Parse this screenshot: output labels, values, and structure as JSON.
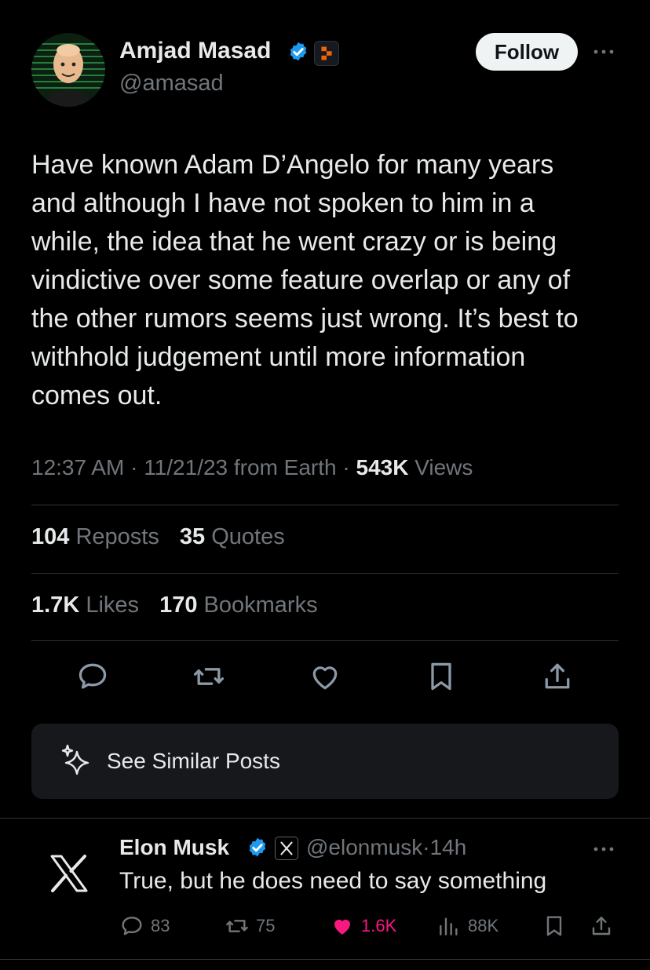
{
  "tweet": {
    "author": {
      "name": "Amjad Masad",
      "handle": "@amasad",
      "verified": true,
      "avatar": "avatar-illustration"
    },
    "follow_label": "Follow",
    "text": "Have known Adam D’Angelo for many years\nand although I have not spoken to him in a\nwhile, the idea that he went crazy or is being\nvindictive over some feature overlap or any of\nthe other rumors seems just wrong. It’s best to\nwithhold judgement until more information\ncomes out.",
    "time": "12:37 AM",
    "date": "11/21/23",
    "source": "from Earth",
    "views_count": "543K",
    "views_label": "Views",
    "separator": "·"
  },
  "stats": {
    "reposts": "104",
    "reposts_label": "Reposts",
    "quotes": "35",
    "quotes_label": "Quotes",
    "likes": "1.7K",
    "likes_label": "Likes",
    "bookmarks": "170",
    "bookmarks_label": "Bookmarks"
  },
  "actions": [
    "reply-icon",
    "repost-icon",
    "like-icon",
    "bookmark-icon",
    "share-icon"
  ],
  "similar_posts": {
    "label": "See Similar Posts",
    "icon": "sparkle-icon"
  },
  "reply": {
    "author_name": "Elon Musk",
    "handle": "@elonmusk",
    "time": "14h",
    "separator": "·",
    "text": "True, but he does need to say something",
    "replies": "83",
    "reposts": "75",
    "likes": "1.6K",
    "views": "88K",
    "avatar": "x-logo-icon"
  },
  "colors": {
    "background": "#000000",
    "text": "#e7e9ea",
    "muted": "#71767b",
    "verified_blue": "#1d9bf0",
    "like_pink": "#f91880",
    "card_bg": "#16181c",
    "divider": "#2f3336"
  }
}
